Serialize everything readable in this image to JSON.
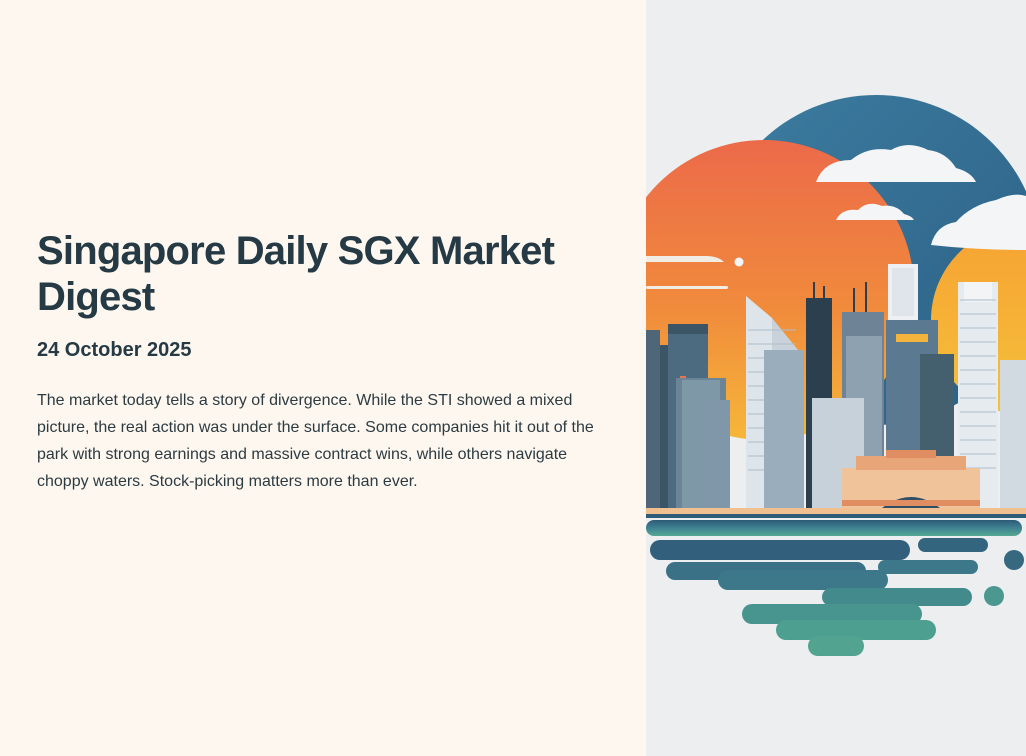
{
  "article": {
    "title": "Singapore Daily SGX Market Digest",
    "date": "24 October 2025",
    "intro": "The market today tells a story of divergence. While the STI showed a mixed picture, the real action was under the surface. Some companies hit it out of the park with strong earnings and massive contract wins, while others navigate choppy waters. Stock-picking matters more than ever."
  },
  "illustration": {
    "subject": "singapore-skyline-illustration",
    "colors": {
      "background": "#eceeef",
      "sky_blue": "#2f6c8f",
      "sun_orange": "#ef7a47",
      "sun_yellow": "#f4ae3a",
      "water_dark": "#2e5d7a",
      "water_teal": "#4d9f90",
      "building_slate": "#5f7a8c",
      "building_light": "#dfe5ea",
      "accent_coral": "#e5764f"
    }
  }
}
